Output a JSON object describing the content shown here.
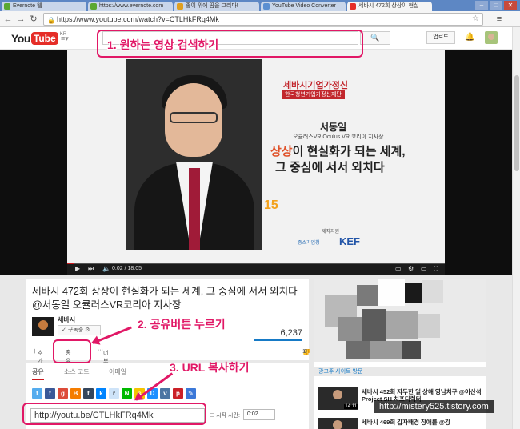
{
  "browser": {
    "tabs": [
      {
        "label": "Evernote 웹",
        "color": "#5aa832"
      },
      {
        "label": "https://www.evernote.com",
        "color": "#5aa832"
      },
      {
        "label": "좋이 위에 꿈을 그리다!",
        "color": "#e0a020"
      },
      {
        "label": "YouTube Video Converter",
        "color": "#5b8fd1"
      },
      {
        "label": "세바시 472회 상상이 현실",
        "color": "#e52d27"
      }
    ],
    "url": "https://www.youtube.com/watch?v=CTLHkFRq4Mk"
  },
  "youtube": {
    "logo_you": "You",
    "logo_tube": "Tube",
    "logo_region": "KR",
    "upload_label": "업로드"
  },
  "video": {
    "conference_title": "세바시기업가정신",
    "conference_sub": "한국청년기업가정신재단",
    "speaker_name": "서동일",
    "speaker_role": "오큘러스VR Oculus VR 코리아 지사장",
    "talk_highlight": "상상",
    "talk_line1_rest": "이 현실화가 되는 세계,",
    "talk_line2": "그 중심에 서서 외치다",
    "anniversary": "15",
    "sponsor_label": "제작지원",
    "logo_mss": "중소기업청",
    "logo_kef": "KEF",
    "time": "0:02 / 18:05",
    "progress": 0.02
  },
  "info": {
    "title": "세바시 472회 상상이 현실화가 되는 세계, 그 중심에 서서 외치다 @서동일 오큘러스VR코리아 지사장",
    "channel": "세바시",
    "subscribe_label": "구독중",
    "views": "6,237",
    "add_label": "추가",
    "share_label": "공유",
    "more_label": "더보기",
    "likes": "17",
    "dislikes": "0"
  },
  "share": {
    "tabs": [
      "공유",
      "소스 코드",
      "이메일"
    ],
    "short_url": "http://youtu.be/CTLHkFRq4Mk",
    "start_label": "시작 시간:",
    "start_value": "0:02"
  },
  "annotations": {
    "step1": "1. 원하는 영상 검색하기",
    "step2": "2. 공유버튼 누르기",
    "step3": "3. URL 복사하기",
    "color": "#e11866"
  },
  "sidebar": {
    "ad_caption": "광고주 사이트 방문",
    "related": [
      {
        "title": "세바시 452회 자두한 일 상해 영남치구 @이산석 Project SH 치프디렉터",
        "duration": "14:11"
      },
      {
        "title": "세바시 469회 갑자배경 장애를 @강",
        "duration": ""
      }
    ]
  },
  "watermark": "http://mistery525.tistory.com"
}
